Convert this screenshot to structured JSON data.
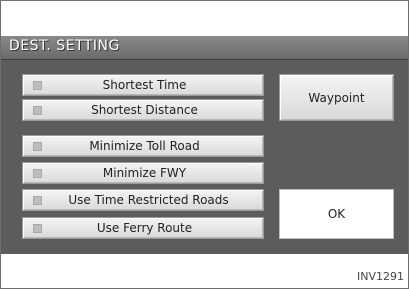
{
  "screen": {
    "title": "DEST. SETTING",
    "options": [
      {
        "label": "Shortest Time"
      },
      {
        "label": "Shortest Distance"
      },
      {
        "label": "Minimize Toll Road"
      },
      {
        "label": "Minimize FWY"
      },
      {
        "label": "Use Time Restricted Roads"
      },
      {
        "label": "Use Ferry Route"
      }
    ],
    "waypoint_label": "Waypoint",
    "ok_label": "OK"
  },
  "figure_code": "INV1291"
}
